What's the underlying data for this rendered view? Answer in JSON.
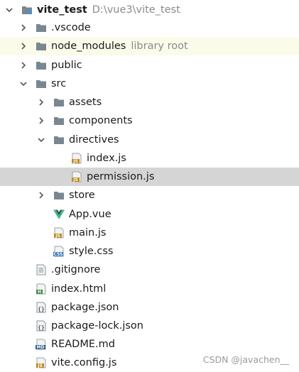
{
  "tree": {
    "root": {
      "name": "vite_test",
      "path": "D:\\vue3\\vite_test"
    },
    "vscode": {
      "name": ".vscode"
    },
    "node_modules": {
      "name": "node_modules",
      "hint": "library root"
    },
    "public": {
      "name": "public"
    },
    "src": {
      "name": "src"
    },
    "assets": {
      "name": "assets"
    },
    "components": {
      "name": "components"
    },
    "directives": {
      "name": "directives"
    },
    "index_js": {
      "name": "index.js",
      "icon_label": "JS"
    },
    "permission_js": {
      "name": "permission.js",
      "icon_label": "JS"
    },
    "store": {
      "name": "store"
    },
    "app_vue": {
      "name": "App.vue"
    },
    "main_js": {
      "name": "main.js",
      "icon_label": "JS"
    },
    "style_css": {
      "name": "style.css",
      "icon_label": "CSS"
    },
    "gitignore": {
      "name": ".gitignore"
    },
    "index_html": {
      "name": "index.html",
      "icon_label": "H"
    },
    "package_json": {
      "name": "package.json",
      "icon_label": "{}"
    },
    "package_lock_json": {
      "name": "package-lock.json",
      "icon_label": "{}"
    },
    "readme_md": {
      "name": "README.md",
      "icon_label": "MD"
    },
    "vite_config_js": {
      "name": "vite.config.js",
      "icon_label": "JS"
    }
  },
  "watermark": "CSDN @javachen__",
  "colors": {
    "folder": "#7a8791",
    "js_badge": "#c08a1e",
    "css_badge": "#2c6fb3",
    "html_badge": "#3e8a3e",
    "md_badge": "#2c5c91",
    "vue_green": "#41b883",
    "vue_dark": "#35495e",
    "selected_row": "#d5d5d5",
    "highlight_row": "#fbfbea"
  }
}
